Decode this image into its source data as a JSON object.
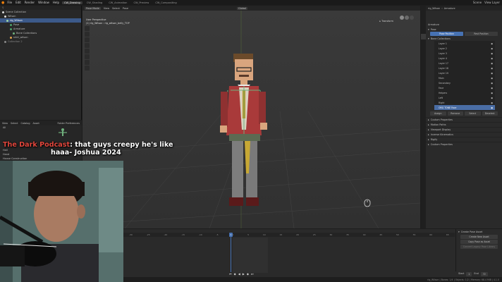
{
  "menubar": {
    "menus": [
      "File",
      "Edit",
      "Render",
      "Window",
      "Help"
    ],
    "workspaces": [
      "CW_Drawing",
      "CW_Shading",
      "CW_Animation",
      "CW_Preview",
      "CW_Compositing"
    ],
    "active_workspace": "CW_Drawing",
    "scene_label": "Scene",
    "view_layer_label": "View Layer"
  },
  "outliner": {
    "root": "Scene Collection",
    "items": [
      "Wilson",
      "rig_Wilson",
      "Pose",
      "Armature",
      "Bone Collections",
      "shirt_wilson",
      "Collection 2"
    ]
  },
  "viewport": {
    "mode": "Pose Mode",
    "menus": [
      "View",
      "Select",
      "Pose"
    ],
    "transform_orientation": "Global",
    "perspective": "User Perspective",
    "object_info": "(1) rig_Wilson : rig_wilson_belly_TOP",
    "transform_label": "Transform"
  },
  "properties": {
    "header_object": "rig_Wilson",
    "header_data": "Armature",
    "datablock": "Armature",
    "pose_label": "Pose",
    "pose_position": "Pose Position",
    "rest_position": "Rest Position",
    "bone_collections_label": "Bone Collections",
    "layers": [
      "Layer 1",
      "Layer 2",
      "Layer 3",
      "Layer 4",
      "Layer 17",
      "Layer 18",
      "Layer 19",
      "Main",
      "Secondary",
      "Face",
      "Helpers",
      "Left",
      "Right",
      "ORG TONE Face"
    ],
    "selected_layer": "ORG TONE Face",
    "assign": "Assign",
    "remove": "Remove",
    "select": "Select",
    "deselect": "Deselect",
    "sections": [
      "Custom Properties",
      "Motion Paths",
      "Viewport Display",
      "Inverse Kinematics",
      "Rigify",
      "Custom Properties"
    ]
  },
  "asset_browser": {
    "menus": [
      "View",
      "Select",
      "Catalog",
      "Asset"
    ],
    "folder_prefs": "Folder Preferences",
    "entries": [
      "All",
      "Hall",
      "Hand",
      "House Construction"
    ]
  },
  "timeline": {
    "ticks": [
      "-30",
      "-25",
      "-20",
      "-15",
      "-10",
      "-5",
      "0",
      "5",
      "10",
      "15",
      "20",
      "25",
      "30",
      "35",
      "40",
      "45",
      "50",
      "55",
      "60",
      "65"
    ],
    "current_frame": "1",
    "start_label": "Start",
    "start_value": "1",
    "end_label": "End",
    "end_value": "72"
  },
  "pose_library": {
    "title": "Create Pose Asset",
    "create_new": "Create New Asset",
    "copy_pose": "Copy Pose as Asset",
    "convert": "Convert Legacy Pose Library"
  },
  "status": {
    "text": "rig_Wilson | Bones: 1/4 | Objects: 1/2 | Memory: 68.4 MiB | 4.1.0"
  },
  "caption": {
    "highlight": "The Dark Podcast",
    "line1_rest": ": that guys creepy he's like",
    "line2": "haaa- Joshua 2024"
  },
  "colors": {
    "accent_blue": "#4772b3",
    "caption_highlight": "#e0463c"
  }
}
